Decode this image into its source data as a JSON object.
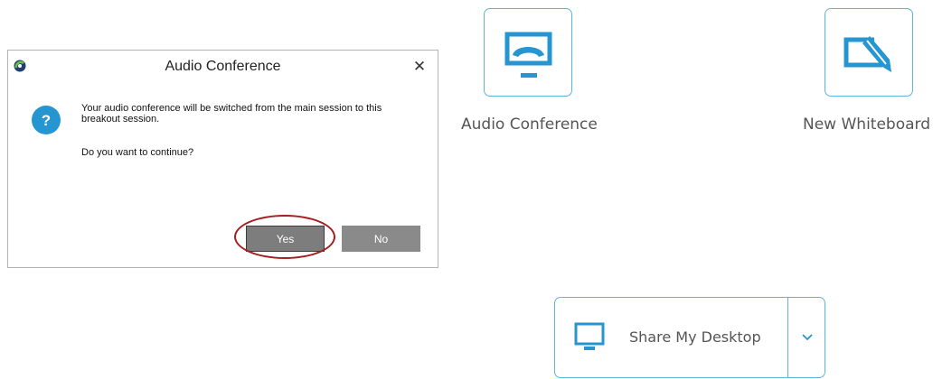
{
  "dialog": {
    "title": "Audio Conference",
    "close_glyph": "✕",
    "message": "Your audio conference will be switched from the main session to this breakout session.",
    "question": "Do you want to continue?",
    "yes_label": "Yes",
    "no_label": "No",
    "question_icon_glyph": "?"
  },
  "tiles": {
    "audio_conference": {
      "label": "Audio Conference",
      "icon": "phone-on-monitor-icon"
    },
    "new_whiteboard": {
      "label": "New Whiteboard",
      "icon": "whiteboard-pen-icon"
    }
  },
  "share": {
    "label": "Share My Desktop",
    "icon": "monitor-icon",
    "dropdown_icon": "chevron-down-icon"
  },
  "colors": {
    "accent_blue": "#2596d1",
    "tile_border": "#5bb5e3",
    "button_gray": "#7d7d7d",
    "highlight_red": "#a31e1e"
  }
}
